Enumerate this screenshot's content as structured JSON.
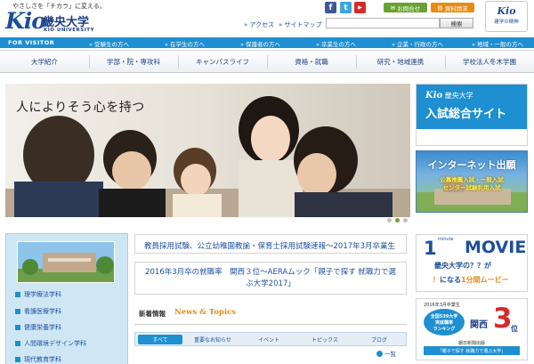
{
  "header": {
    "tagline": "やさしさを「チカラ」に変える。",
    "logo_mark": "Kio",
    "logo_name": "畿央大学",
    "logo_sub": "KIO UNIVERSITY",
    "access_link": "アクセス",
    "sitemap_link": "サイトマップ",
    "contact_button": "お問合せ",
    "docs_button": "資料請求",
    "search": {
      "placeholder": "",
      "button_label": "検索"
    },
    "tour_badge": {
      "logo": "Kio",
      "label": "建学の精神"
    }
  },
  "visitor_nav": {
    "label": "FOR VISITOR",
    "items": [
      "受験生の方へ",
      "在学生の方へ",
      "保護者の方へ",
      "卒業生の方へ",
      "企業・行政の方へ",
      "地域・一般の方へ"
    ]
  },
  "main_nav": {
    "items": [
      "大学紹介",
      "学部・院・専攻科",
      "キャンパスライフ",
      "資格・就職",
      "研究・地域連携",
      "学校法人冬木学園"
    ]
  },
  "hero": {
    "caption": "人によりそう心を持つ"
  },
  "banners": {
    "admission": {
      "logo": "Kio",
      "name": "畿央大学",
      "title": "入試総合サイト"
    },
    "internet": {
      "title": "インターネット出願",
      "sub1": "公募推薦入試・一般入試",
      "sub2": "センター試験利用入試"
    }
  },
  "departments": {
    "items": [
      "理学療法学科",
      "看護医療学科",
      "健康栄養学科",
      "人間環境デザイン学科",
      "現代教育学科"
    ]
  },
  "highlights": [
    "教員採用試験、公立幼稚園教諭・保育士採用試験速報～2017年3月卒業生",
    "2016年3月卒の就職率　関西３位～AERAムック「親子で探す 就職力で選ぶ大学2017」"
  ],
  "news": {
    "title_jp": "新着情報",
    "title_en": "News & Topics",
    "tabs": [
      "すべて",
      "重要なお知らせ",
      "イベント",
      "トピックス",
      "ブログ"
    ],
    "more": "一覧"
  },
  "movie_banner": {
    "number": "1",
    "minute": "minute",
    "word": "MOVIE",
    "line2": "畿央大学の？？が",
    "line3_a": "！",
    "line3_b": "になる",
    "line3_c": "1分間ムービー"
  },
  "rank_banner": {
    "year": "2016年3月卒業生",
    "circle_line1": "全国539大学",
    "circle_line2": "実就職率",
    "circle_line3": "ランキング",
    "region": "関西",
    "rank": "3",
    "unit": "位",
    "source": "朝日新聞出版",
    "book": "「親子で探す 就職力で選ぶ大学」"
  },
  "colors": {
    "brand_blue": "#1e8fd0",
    "navy": "#1d3f82",
    "orange": "#e98a13",
    "green": "#6aa232"
  }
}
